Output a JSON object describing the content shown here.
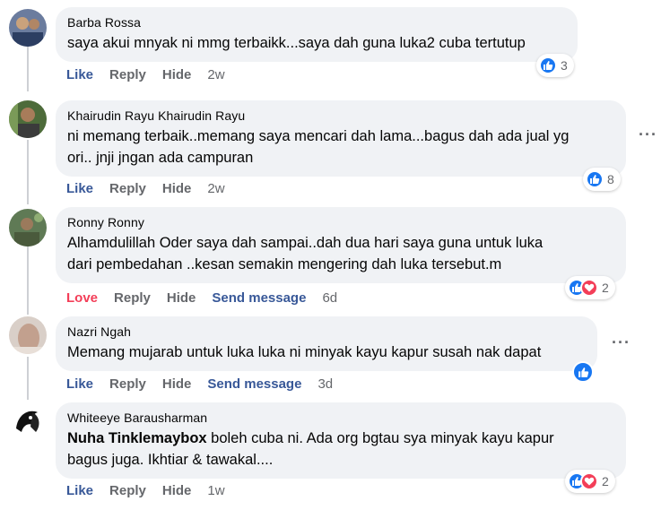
{
  "comments": [
    {
      "author": "Barba Rossa",
      "lines": [
        "saya akui mnyak ni mmg terbaikk...saya dah guna luka2 cuba tertutup"
      ],
      "actions": [
        "Like",
        "Reply",
        "Hide"
      ],
      "time": "2w",
      "reaction_count": "3",
      "reactions": [
        "like"
      ]
    },
    {
      "author": "Khairudin Rayu Khairudin Rayu",
      "lines": [
        "ni memang terbaik..memang saya mencari dah lama...bagus dah ada jual yg",
        "ori.. jnji jngan ada campuran"
      ],
      "actions": [
        "Like",
        "Reply",
        "Hide"
      ],
      "time": "2w",
      "reaction_count": "8",
      "reactions": [
        "like"
      ]
    },
    {
      "author": "Ronny Ronny",
      "lines": [
        "Alhamdulillah Oder saya dah sampai..dah dua hari saya guna untuk luka",
        "dari pembedahan ..kesan semakin mengering dah luka tersebut.m"
      ],
      "actions": [
        "Love",
        "Reply",
        "Hide",
        "Send message"
      ],
      "time": "6d",
      "reaction_count": "2",
      "reactions": [
        "like",
        "love"
      ]
    },
    {
      "author": "Nazri Ngah",
      "lines": [
        "Memang mujarab untuk luka luka ni minyak kayu kapur susah nak dapat"
      ],
      "actions": [
        "Like",
        "Reply",
        "Hide",
        "Send message"
      ],
      "time": "3d",
      "reaction_count": "",
      "reactions": [
        "like"
      ]
    },
    {
      "author": "Whiteeye Barausharman",
      "mention": "Nuha Tinklemaybox",
      "lines": [
        " boleh cuba ni. Ada org bgtau sya minyak kayu kapur",
        "bagus juga. Ikhtiar & tawakal...."
      ],
      "actions": [
        "Like",
        "Reply",
        "Hide"
      ],
      "time": "1w",
      "reaction_count": "2",
      "reactions": [
        "like",
        "love"
      ]
    }
  ],
  "more_icon": "more-horizontal-icon",
  "colors": {
    "like": "#1877f2",
    "love": "#f33e58",
    "link": "#385898",
    "muted": "#65676b",
    "bubble": "#f0f2f5"
  }
}
